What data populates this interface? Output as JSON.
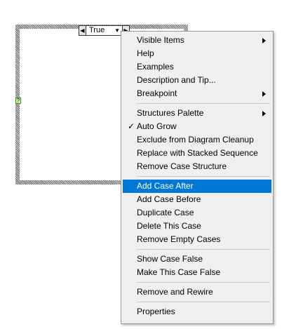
{
  "case_structure": {
    "selector_value": "True"
  },
  "context_menu": {
    "items": [
      {
        "label": "Visible Items",
        "submenu": true
      },
      {
        "label": "Help"
      },
      {
        "label": "Examples"
      },
      {
        "label": "Description and Tip..."
      },
      {
        "label": "Breakpoint",
        "submenu": true
      },
      {
        "label": "Structures Palette",
        "submenu": true
      },
      {
        "label": "Auto Grow",
        "checked": true
      },
      {
        "label": "Exclude from Diagram Cleanup"
      },
      {
        "label": "Replace with Stacked Sequence"
      },
      {
        "label": "Remove Case Structure"
      },
      {
        "label": "Add Case After",
        "highlighted": true
      },
      {
        "label": "Add Case Before"
      },
      {
        "label": "Duplicate Case"
      },
      {
        "label": "Delete This Case"
      },
      {
        "label": "Remove Empty Cases"
      },
      {
        "label": "Show Case False"
      },
      {
        "label": "Make This Case False"
      },
      {
        "label": "Remove and Rewire"
      },
      {
        "label": "Properties"
      }
    ],
    "highlight_color": "#0078d7"
  }
}
